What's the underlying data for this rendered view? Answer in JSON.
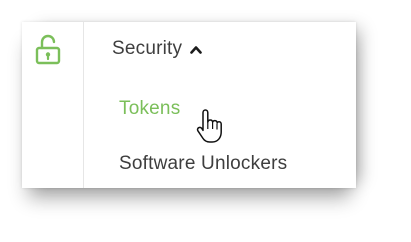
{
  "sidebar": {
    "icon": "lock-open-icon",
    "section": {
      "label": "Security",
      "state_icon": "chevron-up-icon",
      "items": [
        {
          "label": "Tokens",
          "state": "hover"
        },
        {
          "label": "Software Unlockers"
        }
      ]
    }
  },
  "cursor": {
    "icon": "hand-pointer-icon"
  },
  "colors": {
    "accent": "#7bbf5a",
    "text": "#3e3e3e"
  }
}
